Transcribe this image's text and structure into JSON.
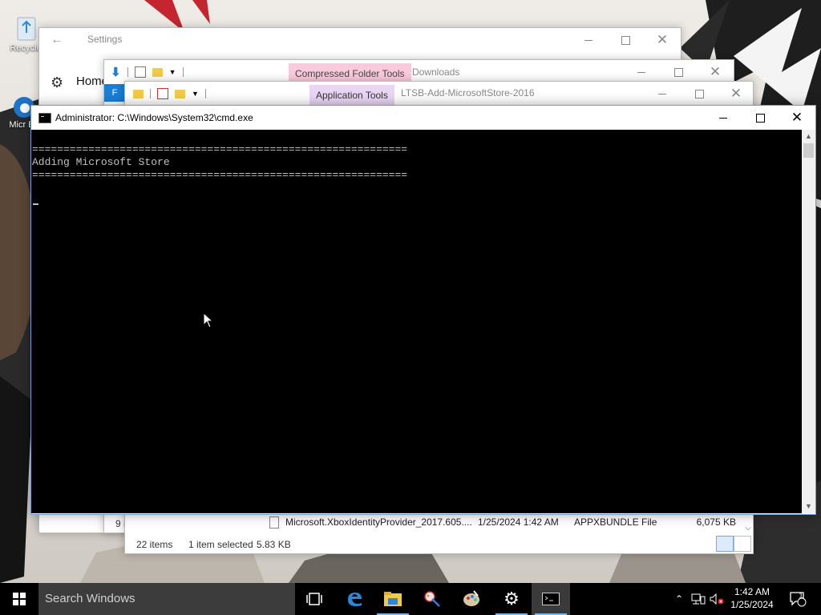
{
  "desktop": {
    "icons": [
      {
        "label": "Recycle",
        "icon": "recycle-bin-icon"
      },
      {
        "label": "Micr Ed",
        "icon": "edge-shortcut-icon"
      }
    ]
  },
  "settings": {
    "title": "Settings",
    "home_label": "Home",
    "icons": {
      "back": "back-arrow-icon",
      "home": "gear-icon"
    }
  },
  "downloads": {
    "context_tab": "Compressed Folder Tools",
    "title": "Downloads",
    "file_tab": "F",
    "item_count": "9 i"
  },
  "ltsb": {
    "context_tab": "Application Tools",
    "title": "LTSB-Add-MicrosoftStore-2016",
    "row": {
      "name": "Microsoft.XboxIdentityProvider_2017.605....",
      "date": "1/25/2024 1:42 AM",
      "type": "APPXBUNDLE File",
      "size": "6,075 KB"
    },
    "status": {
      "items": "22 items",
      "selected": "1 item selected",
      "selected_size": "5.83 KB"
    }
  },
  "cmd": {
    "title": "Administrator: C:\\Windows\\System32\\cmd.exe",
    "lines": [
      "============================================================",
      "Adding Microsoft Store",
      "============================================================"
    ]
  },
  "taskbar": {
    "search_placeholder": "Search Windows",
    "apps": [
      {
        "name": "task-view-icon",
        "running": false
      },
      {
        "name": "edge-icon",
        "running": false
      },
      {
        "name": "file-explorer-icon",
        "running": true
      },
      {
        "name": "paint-icon",
        "running": false
      },
      {
        "name": "paint-palette-icon",
        "running": false
      },
      {
        "name": "settings-gear-icon",
        "running": true
      },
      {
        "name": "command-prompt-icon",
        "running": true,
        "active": true
      }
    ],
    "time": "1:42 AM",
    "date": "1/25/2024",
    "notification_count": "1"
  },
  "colors": {
    "taskbar": "#000000",
    "accent": "#76b9ed",
    "console_bg": "#000000",
    "console_text": "#c0c0c0"
  }
}
